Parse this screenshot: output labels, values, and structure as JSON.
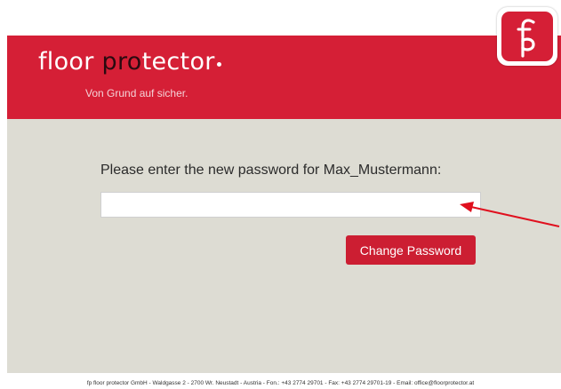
{
  "brand": {
    "name_part1": "floor ",
    "name_highlight": "pro",
    "name_part2": "tector",
    "tagline": "Von Grund auf sicher.",
    "badge_letters": "fp"
  },
  "form": {
    "prompt": "Please enter the new password for Max_Mustermann:",
    "password_value": "",
    "button_label": "Change Password"
  },
  "footer": {
    "text": "fp floor protector GmbH - Waldgasse 2 - 2700 Wr. Neustadt - Austria - Fon.: +43 2774 29701 - Fax: +43 2774 29701-19 - Email: office@floorprotector.at"
  },
  "colors": {
    "brand_red": "#d51f36",
    "content_bg": "#dddcd3",
    "annotation_arrow": "#e0101e"
  },
  "icons": {
    "annotation": "arrow-left-icon"
  }
}
